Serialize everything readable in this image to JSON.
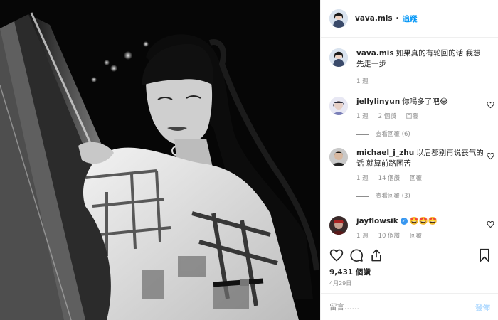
{
  "post": {
    "username": "vava.mis",
    "follow_label": "追蹤",
    "caption": "如果真的有轮回的话 我想先走一步",
    "caption_time": "1 週"
  },
  "comments": [
    {
      "username": "jellylinyun",
      "text": "你喝多了吧😂",
      "time": "1 週",
      "likes": "2 個讚",
      "reply": "回覆",
      "view_replies": "查看回覆 (6)"
    },
    {
      "username": "michael_j_zhu",
      "text": "以后都别再说丧气的话 就算前路困苦",
      "time": "1 週",
      "likes": "14 個讚",
      "reply": "回覆",
      "view_replies": "查看回覆 (3)"
    },
    {
      "username": "jayflowsik",
      "text": "🤩🤩🤩",
      "time": "1 週",
      "likes": "10 個讚",
      "reply": "回覆"
    }
  ],
  "stats": {
    "likes": "9,431 個讚",
    "date": "4月29日"
  },
  "composer": {
    "placeholder": "留言……",
    "post_label": "發佈"
  },
  "icons": {
    "like": "heart-icon",
    "comment": "comment-icon",
    "share": "share-icon",
    "save": "bookmark-icon"
  },
  "colors": {
    "accent": "#0095f6",
    "verified": "#3897f0",
    "muted": "#8e8e8e"
  }
}
